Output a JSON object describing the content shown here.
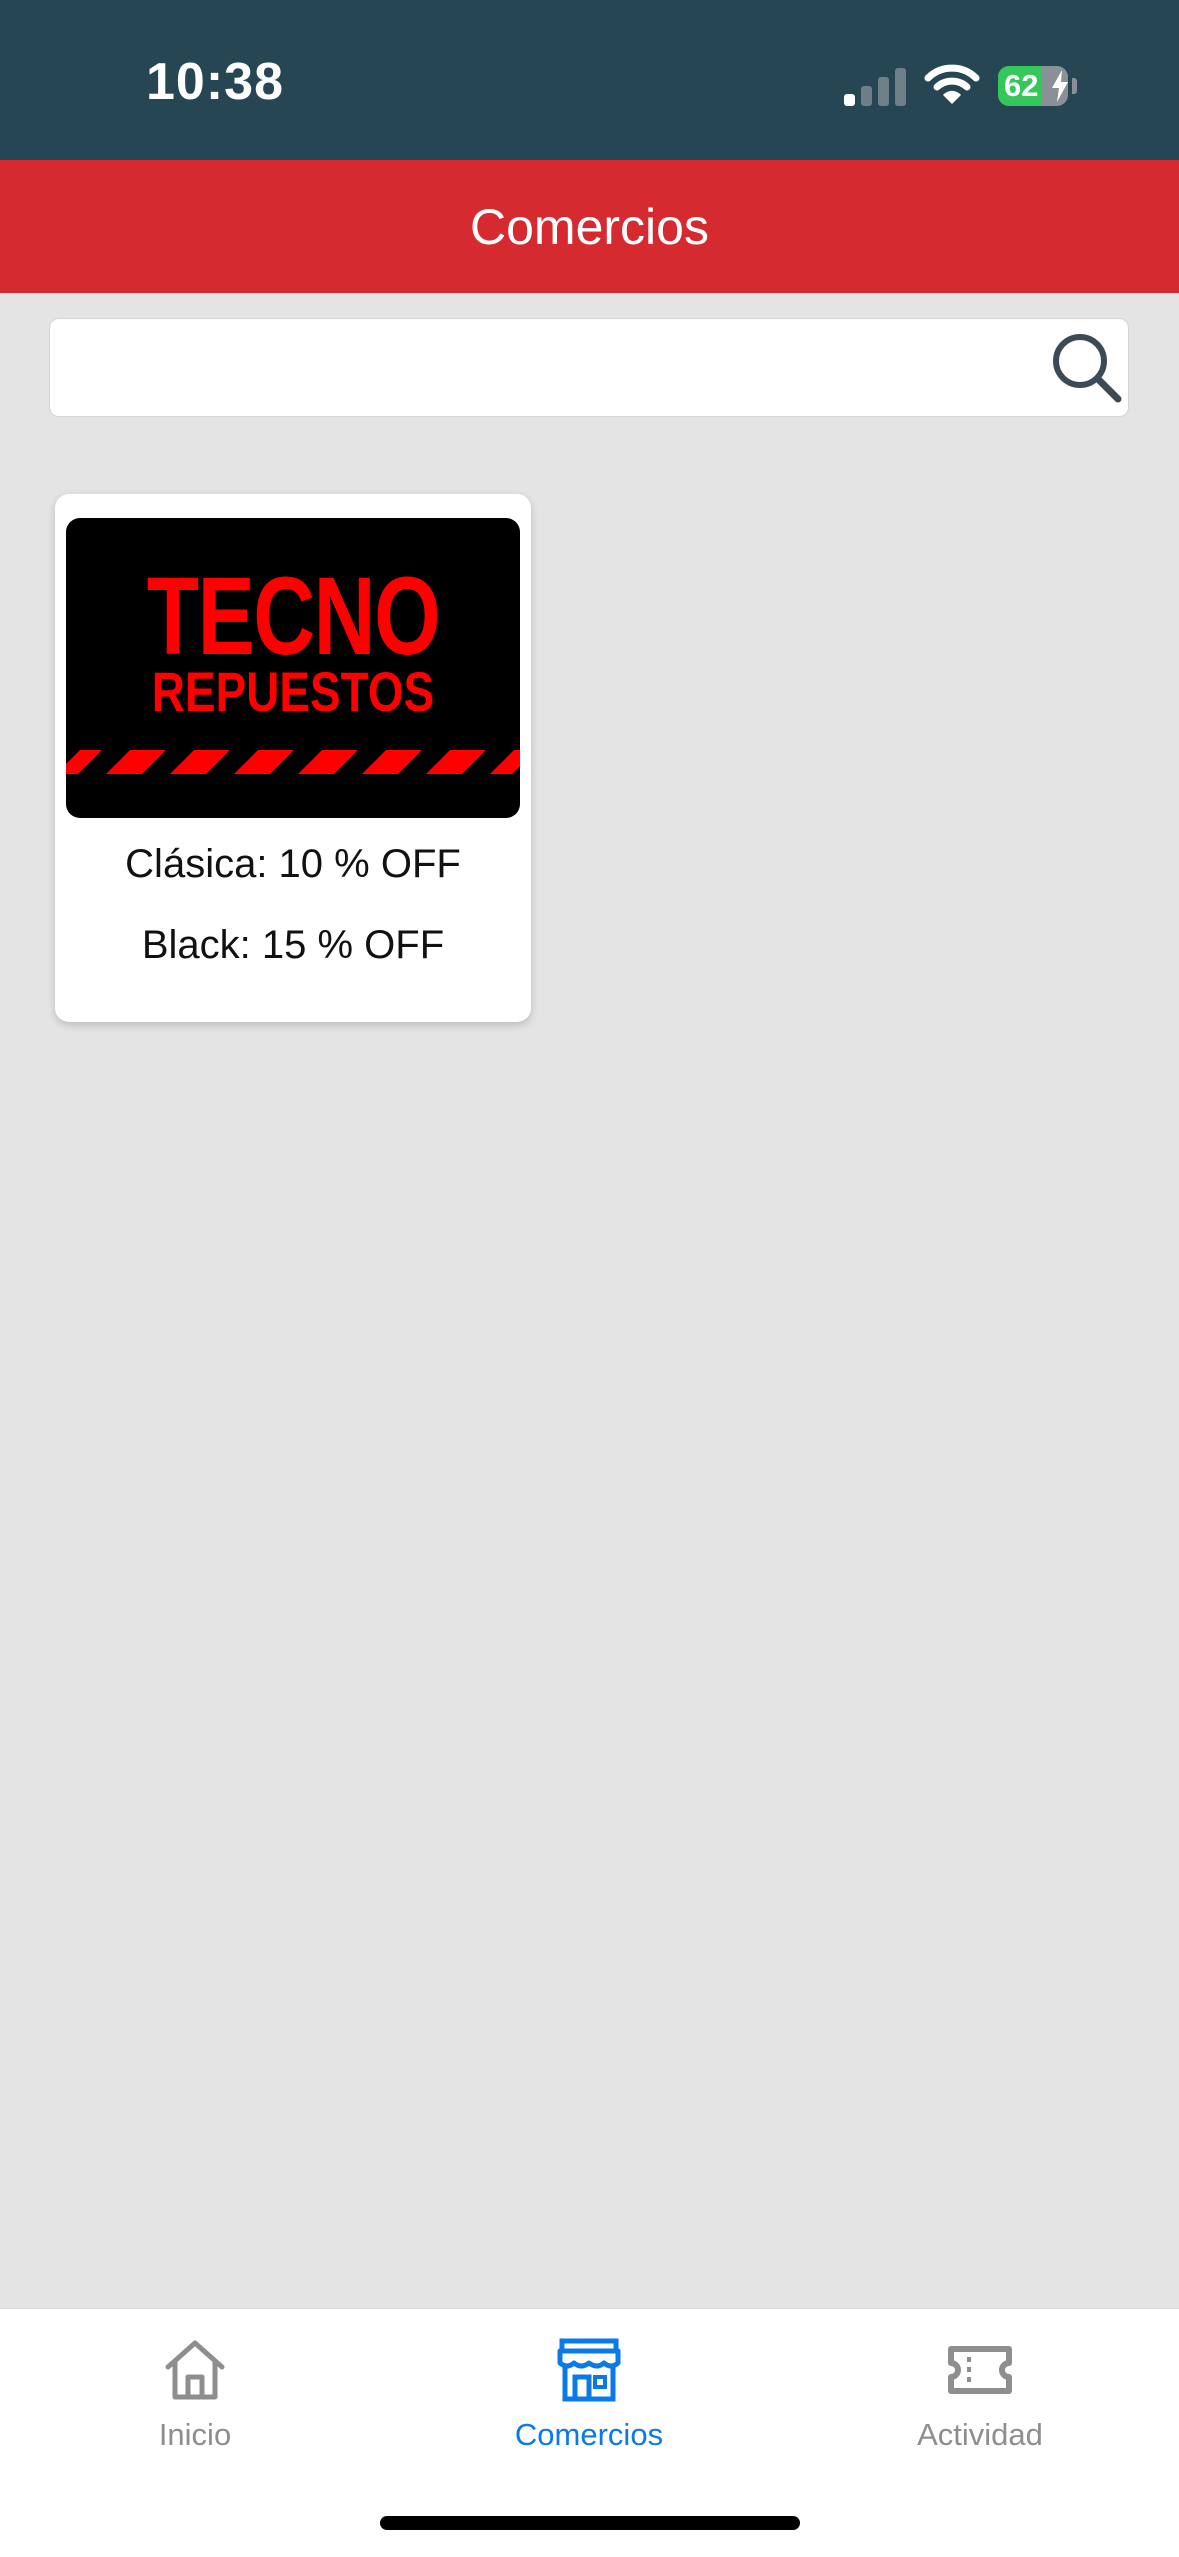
{
  "status_bar": {
    "time": "10:38",
    "battery_level": "62",
    "battery_fraction": 0.62,
    "icons": [
      "cellular-signal-icon",
      "wifi-icon",
      "battery-charging-icon"
    ]
  },
  "header": {
    "title": "Comercios"
  },
  "search": {
    "value": "",
    "icon": "search-icon"
  },
  "merchants": [
    {
      "logo_line1": "TECNO",
      "logo_line2": "REPUESTOS",
      "discounts": [
        "Clásica: 10 % OFF",
        "Black: 15 % OFF"
      ]
    }
  ],
  "tab_bar": {
    "tabs": [
      {
        "label": "Inicio",
        "icon": "home-icon",
        "active": false
      },
      {
        "label": "Comercios",
        "icon": "store-icon",
        "active": true
      },
      {
        "label": "Actividad",
        "icon": "ticket-icon",
        "active": false
      }
    ]
  },
  "colors": {
    "status_bar_bg": "#274653",
    "header_bg": "#d42a30",
    "page_bg": "#e4e4e4",
    "active_tab": "#0a7ae8",
    "inactive_tab": "#8e8e8e",
    "logo_red": "#ff0000"
  }
}
